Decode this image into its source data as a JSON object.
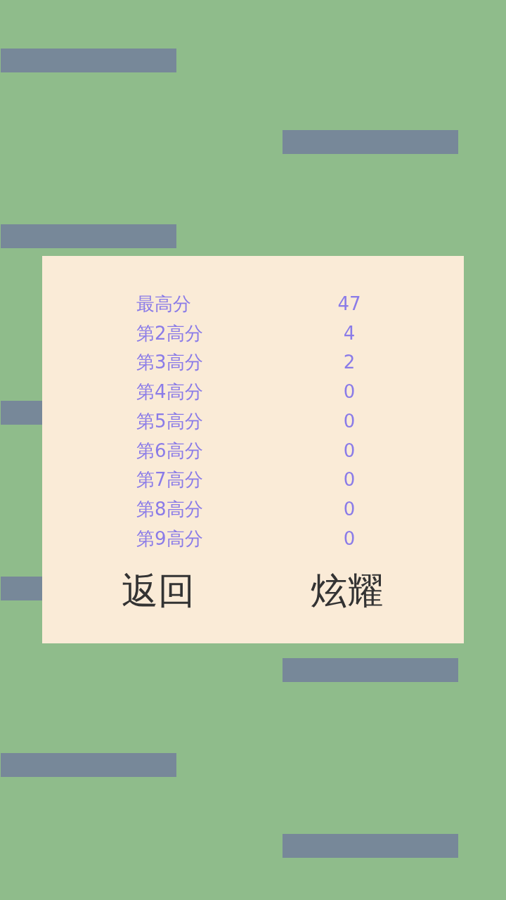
{
  "dialog": {
    "scores": [
      {
        "label": "最高分",
        "value": "47"
      },
      {
        "label": "第2高分",
        "value": "4"
      },
      {
        "label": "第3高分",
        "value": "2"
      },
      {
        "label": "第4高分",
        "value": "0"
      },
      {
        "label": "第5高分",
        "value": "0"
      },
      {
        "label": "第6高分",
        "value": "0"
      },
      {
        "label": "第7高分",
        "value": "0"
      },
      {
        "label": "第8高分",
        "value": "0"
      },
      {
        "label": "第9高分",
        "value": "0"
      }
    ],
    "buttons": [
      {
        "label": "返回"
      },
      {
        "label": "炫耀"
      }
    ]
  }
}
